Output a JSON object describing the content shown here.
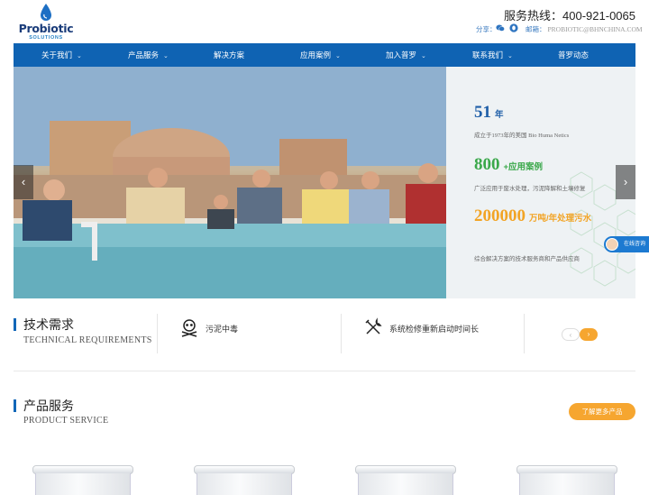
{
  "brand": {
    "name": "Probiotic",
    "sub": "SOLUTIONS",
    "colors": {
      "primary": "#0f63b3",
      "accent": "#f6a630",
      "green": "#3aa84a"
    }
  },
  "header": {
    "hotline_label": "服务热线：",
    "hotline_number": "400-921-0065",
    "share_label": "分享：",
    "email_label": "邮箱：",
    "email": "PROBIOTIC@BHNCHINA.COM",
    "share_icons": [
      "wechat-icon",
      "qq-icon"
    ]
  },
  "nav": {
    "items": [
      {
        "label": "关于我们",
        "has_dropdown": true
      },
      {
        "label": "产品服务",
        "has_dropdown": true
      },
      {
        "label": "解决方案",
        "has_dropdown": false
      },
      {
        "label": "应用案例",
        "has_dropdown": true
      },
      {
        "label": "加入普罗",
        "has_dropdown": true
      },
      {
        "label": "联系我们",
        "has_dropdown": true
      },
      {
        "label": "普罗动态",
        "has_dropdown": false
      }
    ]
  },
  "banner": {
    "stats": [
      {
        "number": "51",
        "unit": "年",
        "desc": "成立于1973年的美国 Bio Huma Netics",
        "color": "#1f5fa8"
      },
      {
        "number": "800",
        "unit": "+应用案例",
        "desc": "广泛应用于废水处理，污泥降解和土壤修复",
        "color": "#3aa84a"
      },
      {
        "number": "200000",
        "unit": "万吨/年处理污水",
        "desc": "综合解决方案的技术服务商和产品供应商",
        "color": "#f2a425"
      }
    ],
    "prev_label": "‹",
    "next_label": "›"
  },
  "chat": {
    "label": "在线咨询"
  },
  "tech": {
    "title": "技术需求",
    "subtitle": "TECHNICAL REQUIREMENTS",
    "items": [
      {
        "label": "污泥中毒",
        "icon": "skull-icon"
      },
      {
        "label": "系统检修重新启动时间长",
        "icon": "tools-icon"
      }
    ],
    "pager_prev": "‹",
    "pager_next": "›"
  },
  "products": {
    "title": "产品服务",
    "subtitle": "PRODUCT SERVICE",
    "more_label": "了解更多产品"
  }
}
